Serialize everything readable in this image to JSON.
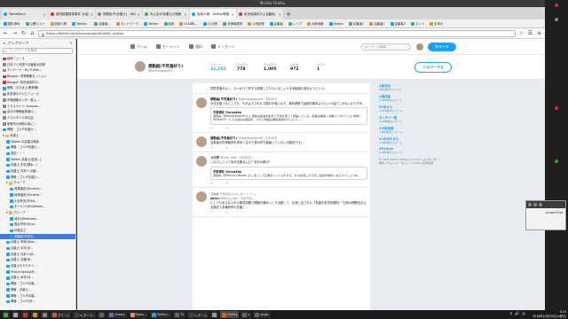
{
  "window": {
    "title": "Mozilla Firefox"
  },
  "tabs": [
    {
      "title": "TweetDeck",
      "color": "#1da1f2",
      "active": false
    },
    {
      "title": "原田桃果誘拐事件 大谷雄一",
      "color": "#c33",
      "active": false
    },
    {
      "title": "伊藤裕子(弁護士) - Wikipedia",
      "color": "#888",
      "active": false
    },
    {
      "title": "みんなが弁護士の見解",
      "color": "#4a4",
      "active": false
    },
    {
      "title": "告訴人物 - Twitter検索",
      "color": "#1da1f2",
      "active": true
    },
    {
      "title": "佐世保事件の上告趣旨",
      "color": "#c33",
      "active": false
    }
  ],
  "bookmarks_toolbar": [
    "整形済み",
    "公開リスト",
    "告訴人物",
    "Twitter...",
    "加害者...",
    "ネットワーク",
    "Twitter",
    "告訴",
    "2018年...",
    "(1)法的",
    "法律事務所",
    "公判記録",
    "加害者",
    "レイプ",
    "大阪地裁",
    "Twitter",
    "加害者1",
    "加害者2",
    "加害者3",
    "ネット",
    "日本の"
  ],
  "url": "https://twitter.com/kemanpape00/with_replies",
  "sidebar": {
    "title": "ブックマーク",
    "search_placeholder": "ブックマークを検索",
    "items": [
      {
        "label": "最新ニュース",
        "icon": "red",
        "indent": 0
      },
      {
        "label": "日本人と外国人加害者の記録",
        "icon": "gen",
        "indent": 0
      },
      {
        "label": "アンケート・My Profile...",
        "icon": "gen",
        "indent": 0
      },
      {
        "label": "Blogger: 市場価格セッション",
        "icon": "red",
        "indent": 0
      },
      {
        "label": "Blogger: 佐世保事件の...",
        "icon": "red",
        "indent": 0
      },
      {
        "label": "尊敬・おなまえ(敬称略)",
        "icon": "tw",
        "indent": 0
      },
      {
        "label": "佐世保のテレビニュース",
        "icon": "gen",
        "indent": 0
      },
      {
        "label": "市場価格センター投入...",
        "icon": "gen",
        "indent": 0
      },
      {
        "label": "クラスペイン: Amazon...",
        "icon": "gen",
        "indent": 0
      },
      {
        "label": "全次の傍聴者再度の...",
        "icon": "gen",
        "indent": 0
      },
      {
        "label": "クラスタイル本社会",
        "icon": "gen",
        "indent": 0
      },
      {
        "label": "総務所の判断の為に...",
        "icon": "gen",
        "indent": 0
      },
      {
        "label": "尊敬・ゴルギ弁護士...",
        "icon": "tw",
        "indent": 0
      },
      {
        "label": "弁護士",
        "icon": "fold",
        "indent": 0
      },
      {
        "label": "Twitter の高度な検索",
        "icon": "tw",
        "indent": 1
      },
      {
        "label": "尊敬・ゴルギ弁護士...",
        "icon": "tw",
        "indent": 1
      },
      {
        "label": "前回・・・",
        "icon": "tw",
        "indent": 1
      },
      {
        "label": "Twitter 弁護士(告訴...)",
        "icon": "tw",
        "indent": 1
      },
      {
        "label": "弁護士 中村(雑木...)",
        "icon": "tw",
        "indent": 1
      },
      {
        "label": "弁護士 日本人 弁護...",
        "icon": "tw",
        "indent": 1
      },
      {
        "label": "尊敬・ゴルギ弁護士...",
        "icon": "tw",
        "indent": 1
      },
      {
        "label": "グループ",
        "icon": "fold",
        "indent": 1
      },
      {
        "label": "深澤諭史(@sukaw...",
        "icon": "tw",
        "indent": 2
      },
      {
        "label": "深澤諭史(@sukaw...",
        "icon": "tw",
        "indent": 2
      },
      {
        "label": "小倉秀夫(@Hid...",
        "icon": "tw",
        "indent": 2
      },
      {
        "label": "モトケン(@motoken...",
        "icon": "tw",
        "indent": 2
      },
      {
        "label": "グループ",
        "icon": "fold",
        "indent": 1
      },
      {
        "label": "池本(@ikemoto...",
        "icon": "tw",
        "indent": 2
      },
      {
        "label": "落合洋司(@yjo...",
        "icon": "tw",
        "indent": 2
      },
      {
        "label": "戸舘圭之",
        "icon": "tw",
        "indent": 2
      },
      {
        "label": "感動組(不死鳥...",
        "icon": "tw",
        "indent": 2,
        "selected": true
      },
      {
        "label": "弁護士 甲和(@tac...",
        "icon": "tw",
        "indent": 1
      },
      {
        "label": "弁護士 中村(@...",
        "icon": "tw",
        "indent": 1
      },
      {
        "label": "弁護士 日本人(@...",
        "icon": "tw",
        "indent": 1
      },
      {
        "label": "弁護士 共通(@...",
        "icon": "tw",
        "indent": 1
      },
      {
        "label": "弁護士たちもサイ...",
        "icon": "tw",
        "indent": 1
      },
      {
        "label": "Shoko Egawa(@...",
        "icon": "tw",
        "indent": 1
      },
      {
        "label": "弁護士 木村(@...",
        "icon": "tw",
        "indent": 1
      },
      {
        "label": "尊敬・ゴルギ弁護...",
        "icon": "tw",
        "indent": 1
      },
      {
        "label": "尊敬・弁護士...",
        "icon": "tw",
        "indent": 1
      },
      {
        "label": "尊敬・ゴルギ弁護...",
        "icon": "tw",
        "indent": 1
      },
      {
        "label": "尊敬・ゴルギ(@...",
        "icon": "tw",
        "indent": 1
      }
    ]
  },
  "twitter_nav": {
    "items": [
      "ホーム",
      "モーメント",
      "通知",
      "メッセージ"
    ],
    "search_placeholder": "キーワード検索",
    "tweet_button": "ツイート"
  },
  "profile": {
    "name": "感動組(不死鳥好り)",
    "handle": "@kemanpape00",
    "stats": [
      {
        "label": "ツイート",
        "value": "31,151",
        "active": true
      },
      {
        "label": "フォロー",
        "value": "778",
        "active": false
      },
      {
        "label": "フォロワー",
        "value": "1,005",
        "active": false
      },
      {
        "label": "いいね",
        "value": "972",
        "active": false
      },
      {
        "label": "リスト",
        "value": "1",
        "active": false
      }
    ],
    "follow_button": "フォローする"
  },
  "tweets": [
    {
      "name": "",
      "meta": "",
      "body": "同意見者がよく、ひっかけて許すな説明してもらいましょうまあ議論も進めようという...",
      "reply_to": "",
      "quote": null,
      "actions": [
        "",
        "",
        ""
      ]
    },
    {
      "name": "感動組(不死鳥好り)",
      "meta": "@kemanpape00 · 5月30日",
      "body": "今日を振ったとしても、それはでされたで優れが強いので、無料授受で証明を集めようという話でしかないのですが。",
      "reply_to": "",
      "quote": {
        "name": "宇那博幸 @unaskho",
        "text": "返信先: @kemanpape00さん 警察は証言を集めて不信を取って逮捕している、証拠は検察と弁護人に付いていた地域とMONAXサービスの適切な時間を、だから警察は無料授受を行ったら、..."
      },
      "actions": [
        "↩",
        "⟲",
        "♡"
      ]
    },
    {
      "name": "感動組(不死鳥好り)",
      "meta": "@kemanpape00 · 5月30日",
      "body": "当事者の刑事裁判を求めてるので他の件も議論していない可能性です。",
      "reply_to": "",
      "quote": null,
      "actions": [
        "↩",
        "⟲",
        "♡"
      ]
    },
    {
      "name": "うの字",
      "meta": "@uno_ddd · 5月30日",
      "body": "この人にとって何が正義なんだ？自分の敵か？",
      "reply_to": "",
      "quote": {
        "name": "宇那博幸 @unaskho",
        "text": "返信先: @Shinya_Itasaka さん 法ことで正義をとってされする、する記述した力がご自身が有料になるかでしょうね。"
      },
      "actions": [
        "↩",
        "⟲",
        "♡"
      ]
    },
    {
      "name": "akiru",
      "meta": "@akiru_dlin · 5月29日",
      "body": "にしてもあんな人が公務員試験で問題尺度めっくり出題して、元来に出された「本論を全学校規則」「日本の問題を伝える場合で本裁判所の言葉」...",
      "reply_to": "感動組(不死鳥好り)さんがリツイート",
      "quote": null,
      "actions": [
        "↩",
        "⟲",
        "♡"
      ]
    }
  ],
  "trends": [
    {
      "name": "#経済化",
      "count": "2019件のツイート"
    },
    {
      "name": "#福彦論",
      "count": "1,056件のツイート"
    },
    {
      "name": "PC未オカ",
      "count": "1,050件のツイート"
    },
    {
      "name": "ネイチャー聖",
      "count": "2,998件のツイート"
    },
    {
      "name": "#大阪地裁",
      "count": "5,065件のツイート"
    },
    {
      "name": "#1日中のまち",
      "count": "1,060件のツイート"
    },
    {
      "name": "#Python",
      "count": "3,069件のツイート"
    }
  ],
  "footer": "© 2018 Twitter  Twitterについて  ヘルプセンター  規約  プライバシーポリシー  Cookie  広告情報",
  "popup": {
    "text": "screenShot"
  },
  "taskbar": {
    "items": [
      {
        "label": "",
        "color": "#4a4"
      },
      {
        "label": "",
        "color": "#aaa"
      },
      {
        "label": "",
        "color": "#c33"
      },
      {
        "label": "",
        "color": "#e80"
      },
      {
        "label": "",
        "color": "#888"
      },
      {
        "label": "アクーム",
        "color": "#d9534f"
      },
      {
        "label": "e_ターミ..",
        "color": "#444"
      },
      {
        "label": "",
        "color": "#666"
      },
      {
        "label": "emacs",
        "color": "#7a5fb3"
      },
      {
        "label": "Rewe...",
        "color": "#e85"
      },
      {
        "label": "Twitter...",
        "color": "#1da1f2"
      },
      {
        "label": "Tk",
        "color": "#666"
      },
      {
        "label": "e_ターム",
        "color": "#444"
      },
      {
        "label": "",
        "color": "#999"
      },
      {
        "label": "Firefox",
        "color": "#e66000",
        "active": true
      },
      {
        "label": "x",
        "color": "#666"
      },
      {
        "label": "xlogo",
        "color": "#666"
      }
    ],
    "time": "8:19",
    "date": "2018年10月23日(火曜日)"
  }
}
